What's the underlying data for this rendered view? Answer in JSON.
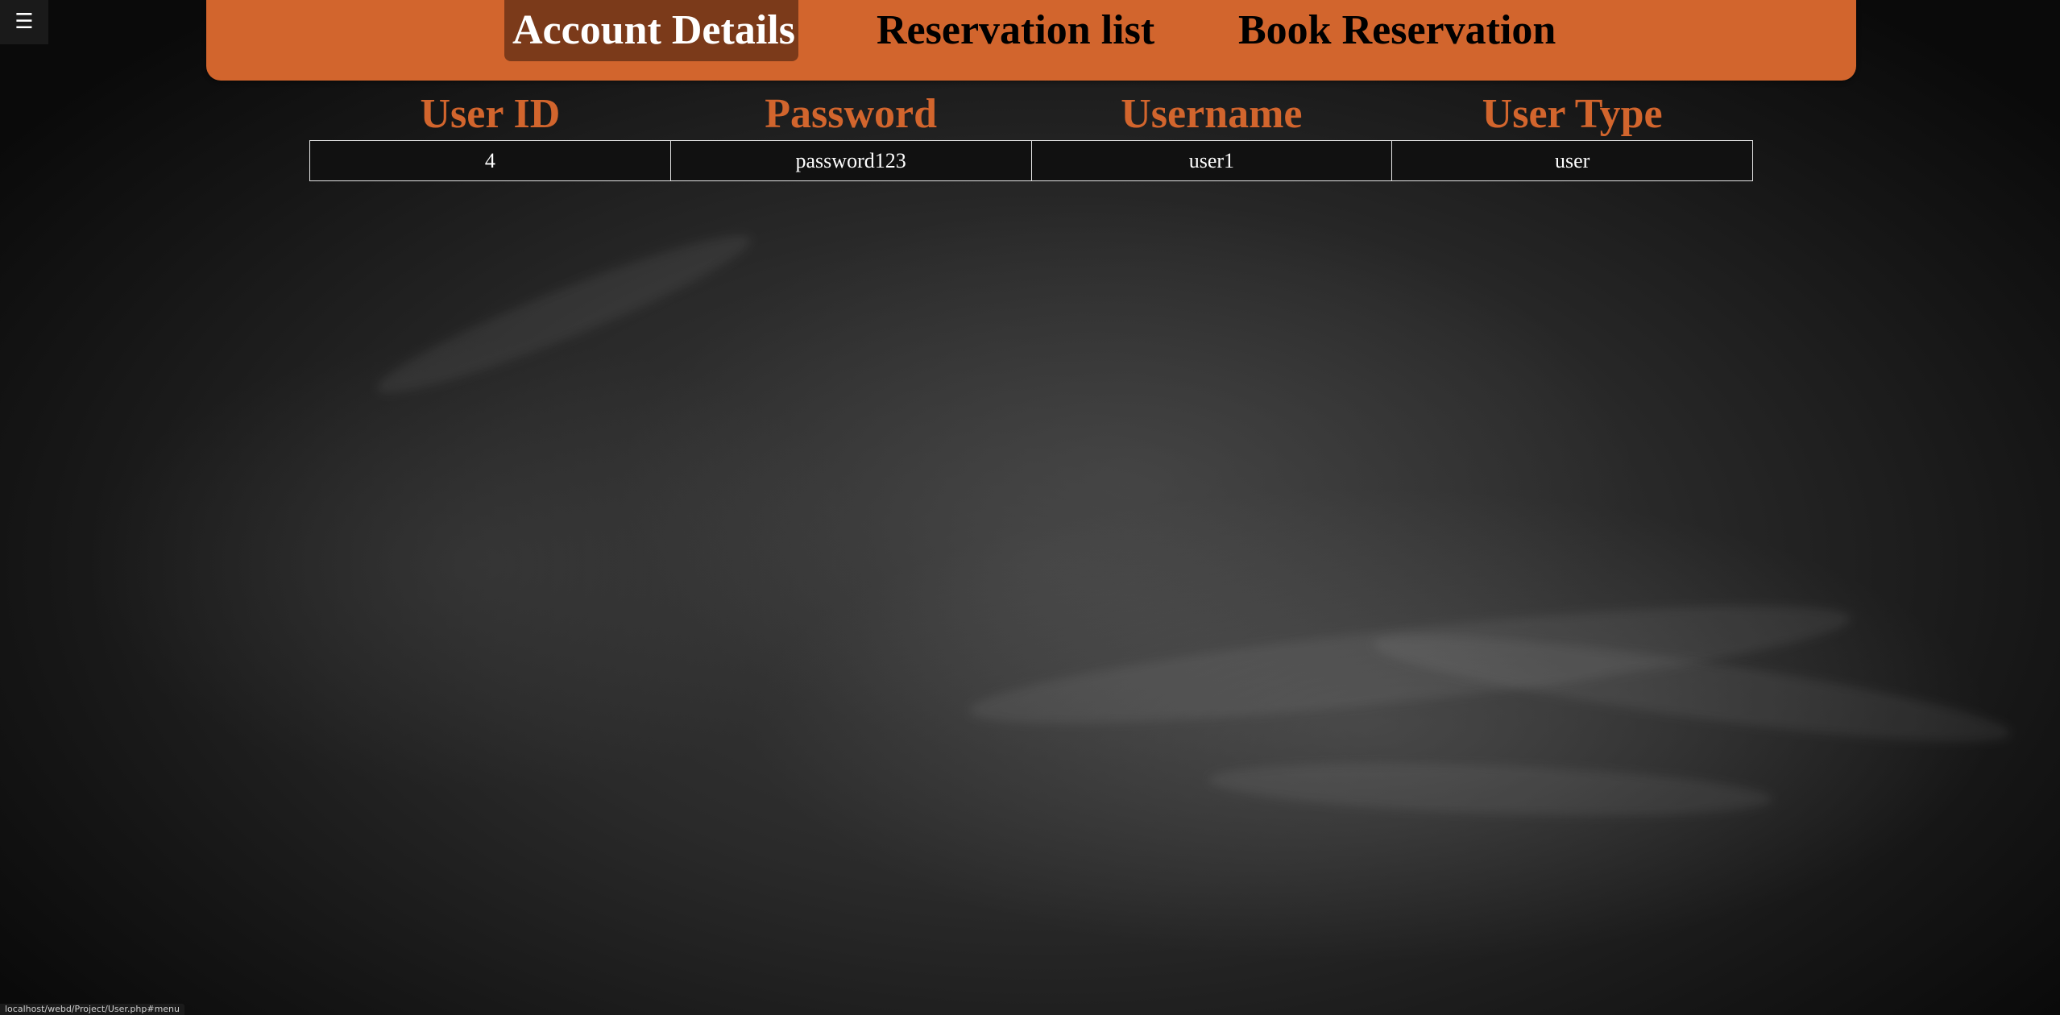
{
  "menu": {
    "icon": "hamburger-menu-icon",
    "glyph": "☰"
  },
  "nav": {
    "items": [
      {
        "label": "Account Details",
        "active": true
      },
      {
        "label": "Reservation list",
        "active": false
      },
      {
        "label": "Book Reservation",
        "active": false
      }
    ]
  },
  "table": {
    "headers": [
      "User ID",
      "Password",
      "Username",
      "User Type"
    ],
    "rows": [
      [
        "4",
        "password123",
        "user1",
        "user"
      ]
    ]
  },
  "status_bar": {
    "url": "localhost/webd/Project/User.php#menu"
  },
  "colors": {
    "accent": "#d2652d",
    "active_tab": "#7b3a1a",
    "background": "#2a2a2a",
    "cell_border": "#e6e6e6"
  }
}
